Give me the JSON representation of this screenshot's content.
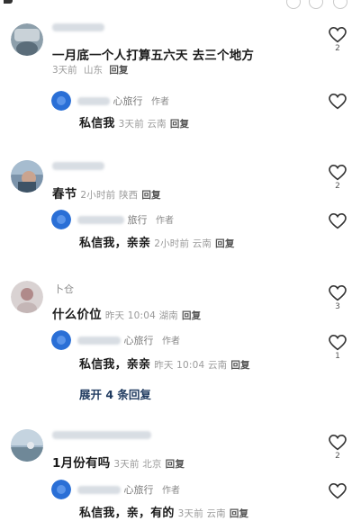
{
  "comments": [
    {
      "text": "一月底一个人打算五六天 去三个地方",
      "time": "3天前",
      "location": "山东",
      "reply_label": "回复",
      "like_count": "2",
      "avatar_color": "#7a8f9c",
      "replies": [
        {
          "name_suffix": "心旅行",
          "author_tag": "作者",
          "text": "私信我",
          "time": "3天前",
          "location": "云南",
          "reply_label": "回复",
          "like_count": ""
        }
      ]
    },
    {
      "text": "春节",
      "time": "2小时前",
      "location": "陕西",
      "reply_label": "回复",
      "like_count": "2",
      "avatar_color": "#6f8aa6",
      "replies": [
        {
          "name_suffix": "旅行",
          "author_tag": "作者",
          "text": "私信我，亲亲",
          "time": "2小时前",
          "location": "云南",
          "reply_label": "回复",
          "like_count": ""
        }
      ]
    },
    {
      "name": "卜仓",
      "text": "什么价位",
      "time": "昨天 10:04",
      "location": "湖南",
      "reply_label": "回复",
      "like_count": "3",
      "avatar_color": "#b9a6a6",
      "replies": [
        {
          "name_suffix": "心旅行",
          "author_tag": "作者",
          "text": "私信我，亲亲",
          "time": "昨天 10:04",
          "location": "云南",
          "reply_label": "回复",
          "like_count": "1"
        }
      ],
      "expand_label": "展开 4 条回复"
    },
    {
      "text": "1月份有吗",
      "time": "3天前",
      "location": "北京",
      "reply_label": "回复",
      "like_count": "2",
      "avatar_color": "#8aa3b8",
      "replies": [
        {
          "name_suffix": "心旅行",
          "author_tag": "作者",
          "text": "私信我，亲，有的",
          "time": "3天前",
          "location": "云南",
          "reply_label": "回复",
          "like_count": ""
        }
      ]
    }
  ],
  "colors": {
    "reply_avatar": "#2a6fd6",
    "heart_stroke": "#333333",
    "expand_text": "#1f3a5f"
  },
  "icons": [
    "heart-outline-icon"
  ]
}
